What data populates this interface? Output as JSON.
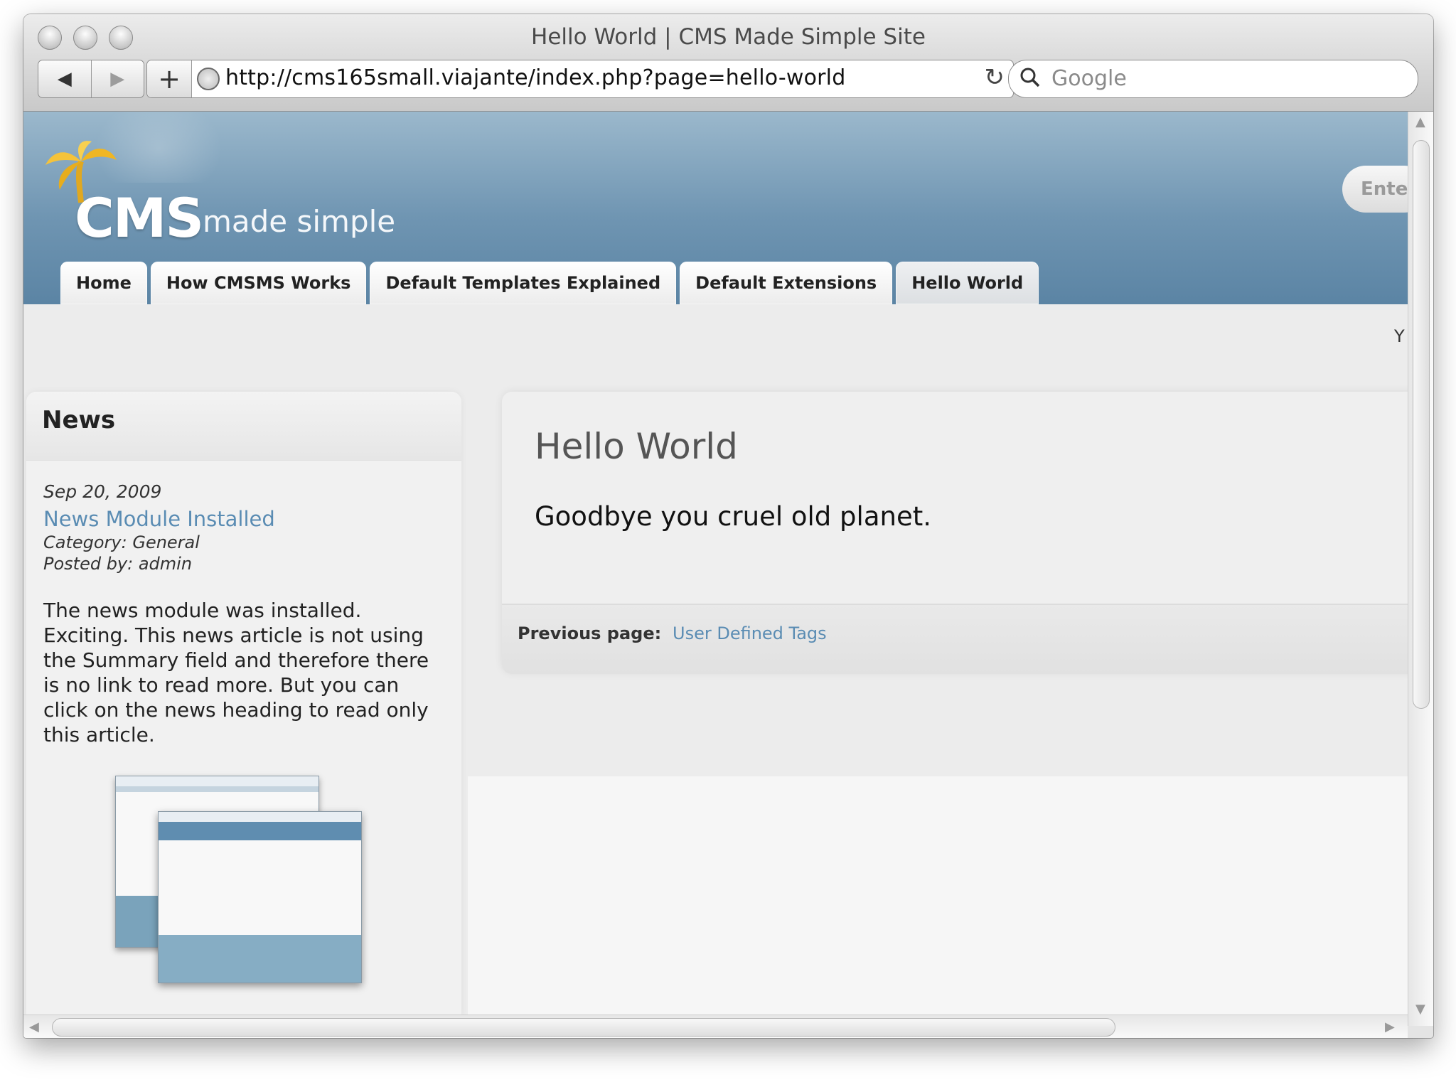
{
  "window": {
    "title": "Hello World | CMS Made Simple Site"
  },
  "toolbar": {
    "back_glyph": "◀",
    "forward_glyph": "▶",
    "add_glyph": "+",
    "url": "http://cms165small.viajante/index.php?page=hello-world",
    "reload_glyph": "↻",
    "search_placeholder": "Google"
  },
  "site": {
    "logo_main": "CMS",
    "logo_sub": "made simple",
    "search_pill": "Ente",
    "nav": [
      "Home",
      "How CMSMS Works",
      "Default Templates Explained",
      "Default Extensions",
      "Hello World"
    ],
    "active_nav": "Hello World",
    "right_fragment": "Y"
  },
  "news": {
    "title": "News",
    "date": "Sep 20, 2009",
    "headline": "News Module Installed",
    "category": "Category: General",
    "posted": "Posted by: admin",
    "body": "The news module was installed. Exciting. This news article is not using the Summary field and therefore there is no link to read more. But you can click on the news heading to read only this article."
  },
  "content": {
    "title": "Hello World",
    "text": "Goodbye you cruel old planet.",
    "prev_label": "Previous page:",
    "prev_link": "User Defined Tags"
  },
  "colors": {
    "link": "#5a8cb3",
    "header_blue": "#6f95b2"
  },
  "icons": [
    "close-button-icon",
    "minimize-button-icon",
    "zoom-button-icon",
    "back-icon",
    "forward-icon",
    "plus-icon",
    "globe-icon",
    "reload-icon",
    "search-icon",
    "palm-tree-icon"
  ]
}
